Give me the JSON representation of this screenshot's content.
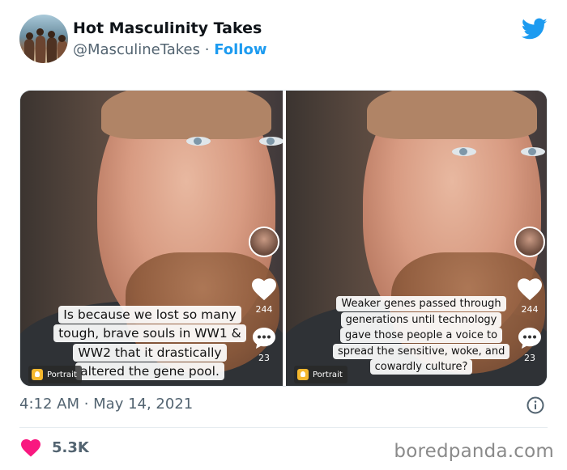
{
  "tweet": {
    "display_name": "Hot Masculinity Takes",
    "handle": "@MasculineTakes",
    "separator": " · ",
    "follow_label": "Follow",
    "brand_icon": "twitter-bird-icon",
    "brand_color": "#1d9bf0",
    "timestamp": "4:12 AM · May 14, 2021",
    "like_count": "5.3K",
    "like_color": "#f91880"
  },
  "media": {
    "panels": [
      {
        "caption": "Is because we lost so many tough, brave souls in WW1 & WW2 that it drastically altered the gene pool.",
        "like_count": "244",
        "comment_count": "23",
        "portrait_label": "Portrait"
      },
      {
        "caption": "Weaker genes passed through generations until technology gave those people a voice to spread the sensitive, woke, and cowardly culture?",
        "like_count": "244",
        "comment_count": "23",
        "portrait_label": "Portrait"
      }
    ]
  },
  "watermark": "boredpanda.com"
}
